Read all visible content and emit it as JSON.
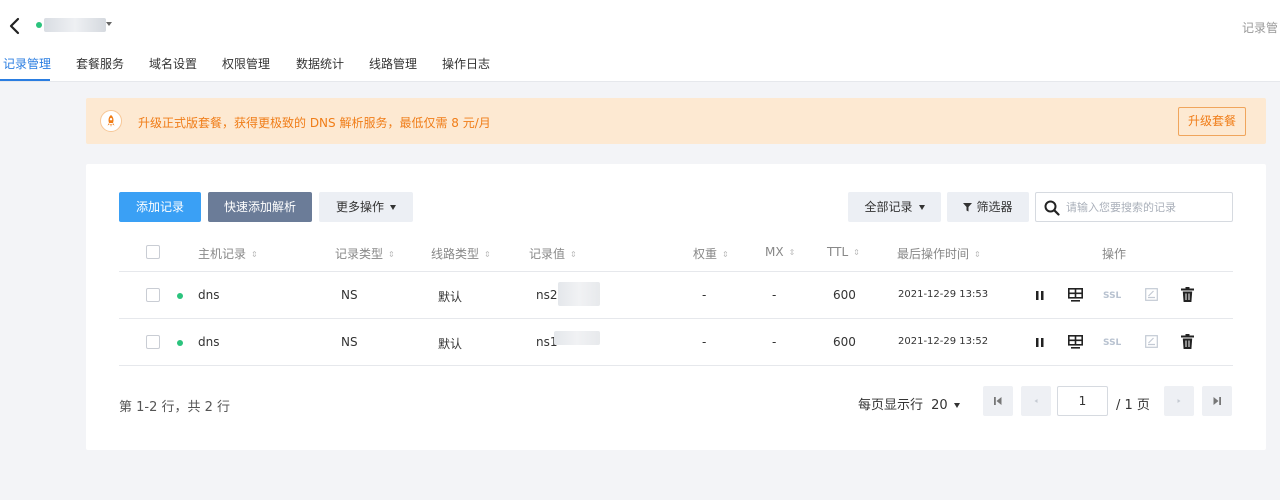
{
  "header": {
    "right_text": "记录管",
    "tabs": [
      "记录管理",
      "套餐服务",
      "域名设置",
      "权限管理",
      "数据统计",
      "线路管理",
      "操作日志"
    ]
  },
  "notice": {
    "text": "升级正式版套餐，获得更极致的 DNS 解析服务，最低仅需 8 元/月",
    "button": "升级套餐"
  },
  "toolbar": {
    "add_record": "添加记录",
    "quick_add": "快速添加解析",
    "more_ops": "更多操作",
    "all_records": "全部记录",
    "filter": "筛选器",
    "search_placeholder": "请输入您要搜索的记录"
  },
  "table": {
    "columns": [
      "主机记录",
      "记录类型",
      "线路类型",
      "记录值",
      "权重",
      "MX",
      "TTL",
      "最后操作时间",
      "操作"
    ],
    "rows": [
      {
        "host": "dns",
        "type": "NS",
        "line": "默认",
        "value": "ns2.",
        "weight": "-",
        "mx": "-",
        "ttl": "600",
        "time": "2021-12-29 13:53",
        "ssl": "SSL"
      },
      {
        "host": "dns",
        "type": "NS",
        "line": "默认",
        "value": "ns1",
        "weight": "-",
        "mx": "-",
        "ttl": "600",
        "time": "2021-12-29 13:52",
        "ssl": "SSL"
      }
    ]
  },
  "pagination": {
    "info": "第 1-2 行，共 2 行",
    "per_page_label": "每页显示行",
    "per_page_value": "20",
    "current_page": "1",
    "total_pages": "/ 1 页"
  },
  "colors": {
    "accent": "#2a7de1",
    "primary_button": "#3aa0f5",
    "status_green": "#2bc37d",
    "notice_bg": "#fde9d2",
    "notice_text": "#f07d18"
  }
}
